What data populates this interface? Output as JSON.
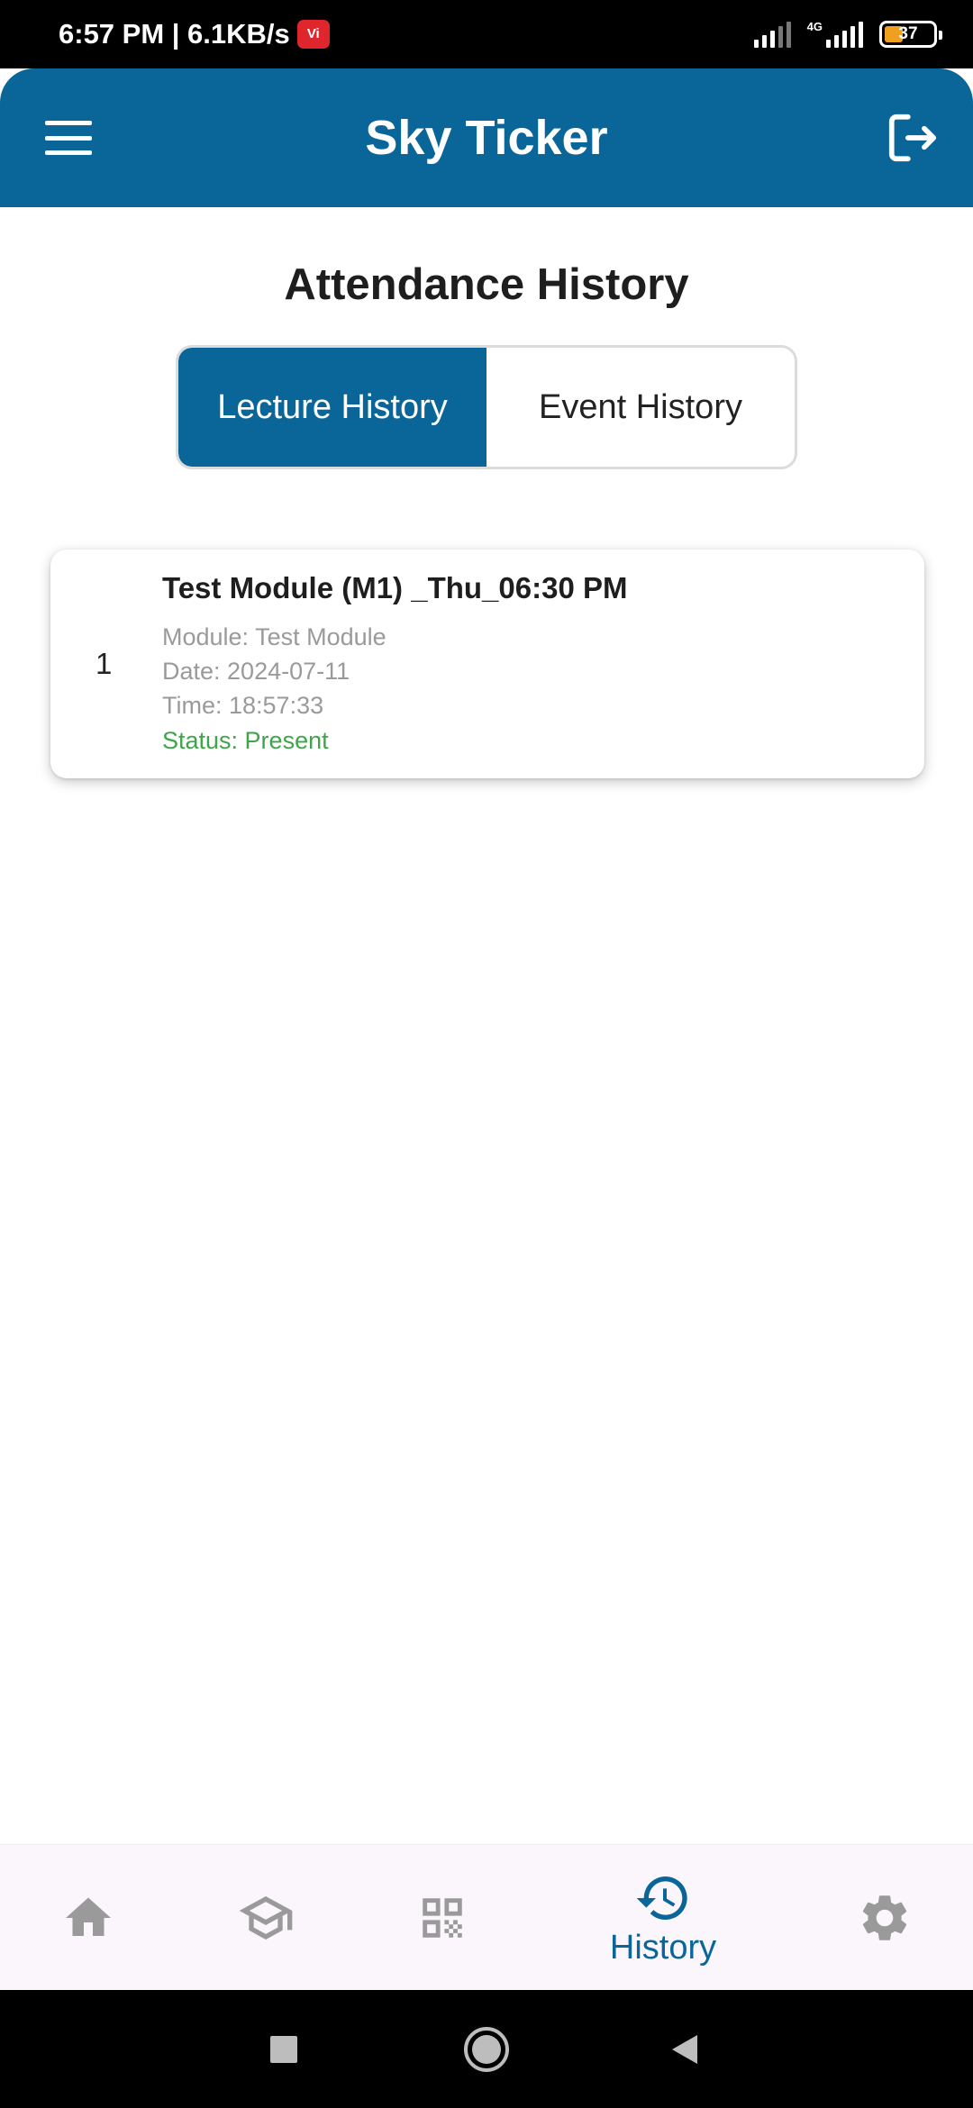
{
  "status_bar": {
    "time": "6:57 PM | 6.1KB/s",
    "carrier_badge": "Vi",
    "network_type": "4G",
    "battery": "37"
  },
  "app_bar": {
    "title": "Sky Ticker",
    "menu_icon": "hamburger-menu-icon",
    "logout_icon": "logout-icon"
  },
  "page": {
    "title": "Attendance History"
  },
  "tabs": [
    {
      "label": "Lecture History",
      "active": true
    },
    {
      "label": "Event History",
      "active": false
    }
  ],
  "records": [
    {
      "index": "1",
      "title": "Test Module (M1) _Thu_06:30 PM",
      "module": "Module: Test Module",
      "date": "Date: 2024-07-11",
      "time": "Time: 18:57:33",
      "status": "Status: Present"
    }
  ],
  "bottom_nav": {
    "items": [
      {
        "icon": "home-icon",
        "label": "",
        "active": false
      },
      {
        "icon": "graduation-cap-icon",
        "label": "",
        "active": false
      },
      {
        "icon": "qr-code-icon",
        "label": "",
        "active": false
      },
      {
        "icon": "history-icon",
        "label": "History",
        "active": true
      },
      {
        "icon": "settings-gear-icon",
        "label": "",
        "active": false
      }
    ]
  },
  "colors": {
    "primary": "#0a6598",
    "status_present": "#3fa548",
    "muted_text": "#9a9a9a",
    "nav_inactive": "#9a9a9a"
  }
}
